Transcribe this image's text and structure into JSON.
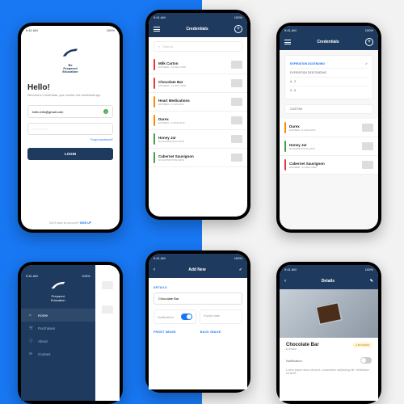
{
  "statusbar": {
    "time": "9:41 AM",
    "battery": "100%"
  },
  "brand": {
    "line1": "Be",
    "line2": "Prepared",
    "line3": "Education"
  },
  "login": {
    "hello": "Hello!",
    "sub": "Welcome to Credentials, your number one credentials app.",
    "email": "hello.info@gmail.com",
    "forgot": "Forgot password?",
    "login_btn": "LOGIN",
    "no_account": "Don't have an account? ",
    "signup": "SIGN UP"
  },
  "credentials": {
    "title": "Credentials",
    "search_placeholder": "Search...",
    "items": [
      {
        "title": "Milk Carton",
        "sub": "EXPIRED • 12 DEC 2018"
      },
      {
        "title": "Chocolate Bar",
        "sub": "EXPIRED • 12 DEC 2018"
      },
      {
        "title": "Heart Medications",
        "sub": "EXPIRES • 3 JAN 2019"
      },
      {
        "title": "Durex",
        "sub": "EXPIRES • 4 MAR 2019"
      },
      {
        "title": "Honey Jar",
        "sub": "NO EXPIRATION DATE"
      },
      {
        "title": "Cabernet Sauvignon",
        "sub": "NO EXPIRATION DATE"
      }
    ]
  },
  "sort": {
    "title": "Credentials",
    "opt1": "EXPIRATION ASCENDING",
    "opt2": "EXPIRATION DESCENDING",
    "opt3": "A - Z",
    "opt4": "Z - A",
    "custom": "CUSTOM",
    "items": [
      {
        "title": "Durex",
        "sub": "EXPIRES • 4 MAR 2019"
      },
      {
        "title": "Honey Jar",
        "sub": "NO EXPIRATION DATE"
      },
      {
        "title": "Cabernet Sauvignon",
        "sub": "EXPIRED • 12 DEC 2018"
      }
    ]
  },
  "drawer": {
    "items": [
      {
        "icon": "home",
        "label": "Home"
      },
      {
        "icon": "cart",
        "label": "Purchases"
      },
      {
        "icon": "info",
        "label": "About"
      },
      {
        "icon": "mail",
        "label": "Contact"
      }
    ]
  },
  "addnew": {
    "title": "Add New",
    "section_details": "DETAILS",
    "name": "Chocolate Bar",
    "notif_label": "Notification",
    "expiry_ph": "Expiry date",
    "section_photo": "FRONT IMAGE",
    "section_back": "BACK IMAGE"
  },
  "details": {
    "title": "Details",
    "name": "Chocolate Bar",
    "code": "● B173HDW",
    "sub": "EXPIRED",
    "notif_label": "Notification",
    "lorem": "Lorem ipsum dolor sit amet, consectetur adipiscing elit. Vestibulum sit amet."
  }
}
